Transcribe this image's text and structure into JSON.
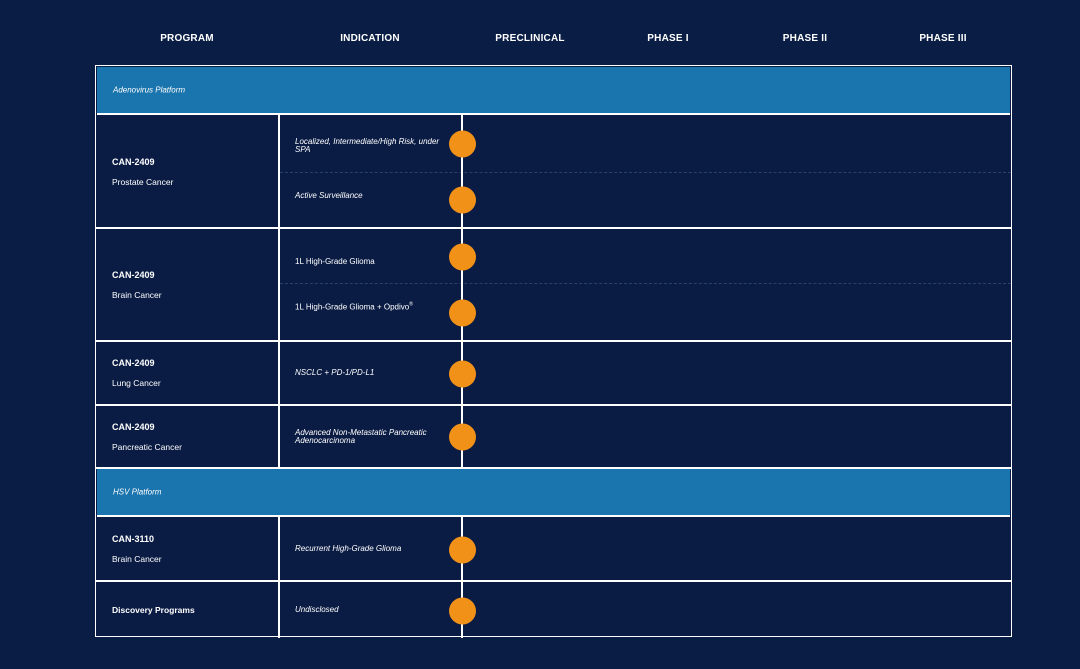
{
  "headers": {
    "program": "PROGRAM",
    "indication": "INDICATION",
    "preclinical": "PRECLINICAL",
    "phase1": "PHASE I",
    "phase2": "PHASE II",
    "phase3": "PHASE III"
  },
  "platforms": {
    "adenovirus": "Adenovirus Platform",
    "hsv": "HSV Platform"
  },
  "programs": {
    "prostate": {
      "name": "CAN-2409",
      "indication_group": "Prostate Cancer"
    },
    "brain": {
      "name": "CAN-2409",
      "indication_group": "Brain Cancer"
    },
    "lung": {
      "name": "CAN-2409",
      "indication_group": "Lung Cancer"
    },
    "pancreatic": {
      "name": "CAN-2409",
      "indication_group": "Pancreatic Cancer"
    },
    "brain3110": {
      "name": "CAN-3110",
      "indication_group": "Brain Cancer"
    },
    "discovery": {
      "name": "Discovery Programs"
    }
  },
  "indications": {
    "prostate_1": "Localized, Intermediate/High Risk, under SPA",
    "prostate_2": "Active Surveillance",
    "brain_1": "1L High-Grade Glioma",
    "brain_2": "1L High-Grade Glioma + Opdivo",
    "brain_2_mark": "®",
    "lung_1": "NSCLC + PD-1/PD-L1",
    "pancreatic_1": "Advanced Non-Metastatic Pancreatic Adenocarcinoma",
    "brain3110_1": "Recurrent High-Grade Glioma",
    "discovery_1": "Undisclosed"
  },
  "progress_stage": "Preclinical",
  "colors": {
    "background": "#0a1d44",
    "platform_band": "#1a74ad",
    "progress_marker": "#f29118",
    "grid_line": "#ffffff"
  }
}
